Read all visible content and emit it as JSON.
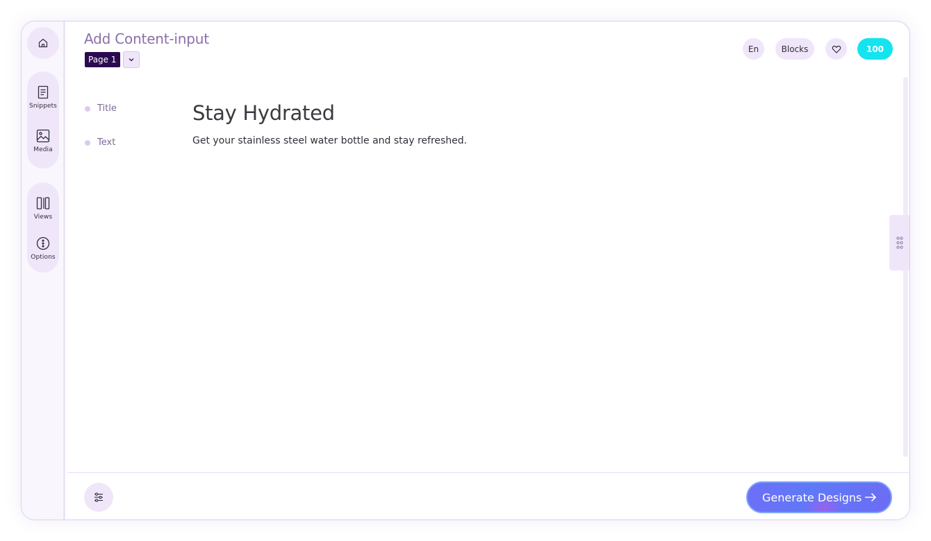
{
  "sidebar": {
    "home_icon": "home-icon",
    "items": [
      {
        "label": "Snippets",
        "icon": "document-icon"
      },
      {
        "label": "Media",
        "icon": "image-icon"
      },
      {
        "label": "Views",
        "icon": "columns-icon"
      },
      {
        "label": "Options",
        "icon": "more-vertical-circle-icon"
      }
    ]
  },
  "header": {
    "title": "Add Content-input",
    "page_select": "Page 1",
    "language": "En",
    "blocks_label": "Blocks",
    "credits": "100"
  },
  "fields": [
    {
      "label": "Title",
      "value": "Stay Hydrated"
    },
    {
      "label": "Text",
      "value": "Get your stainless steel water bottle and stay refreshed."
    }
  ],
  "footer": {
    "generate_label": "Generate Designs"
  },
  "colors": {
    "accent_purple": "#2b0a4f",
    "pill_background": "#f0e6fa",
    "credits_badge": "#14e4ef",
    "generate_gradient_start": "#6d6ff7",
    "title_color": "#8a6fa8"
  }
}
